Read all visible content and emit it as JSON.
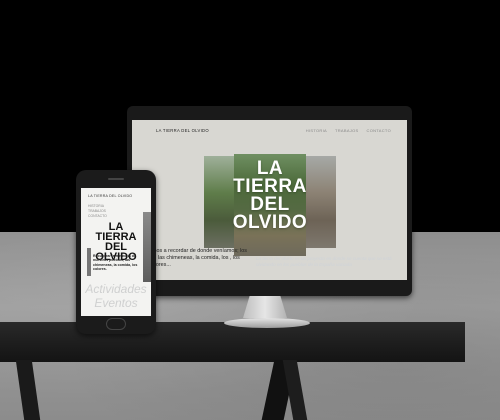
{
  "desktop": {
    "site_logo": "LA TIERRA DEL OLVIDO",
    "nav": [
      "HISTORIA",
      "TRABAJOS",
      "CONTACTO"
    ],
    "hero_title_lines": [
      "LA",
      "TIERRA",
      "DEL",
      "OLVIDO"
    ],
    "body_text": "amos a recordar de donde veníamos; los do, las chimeneas, la comida, los , los colores...",
    "side_text": "La tierra del olvido es un proyecto en donde se cuenta que se está olvidando en los pueblos de la España vaciada"
  },
  "mobile": {
    "site_logo": "LA TIERRA DEL OLVIDO",
    "menu": [
      "HISTORIA",
      "TRABAJOS",
      "CONTACTO"
    ],
    "title_lines": [
      "LA",
      "TIERRA",
      "DEL",
      "OLVIDO"
    ],
    "body_text": "Recuperar la memoria de nuestros pueblos, las chimeneas, la comida, los colores.",
    "big_labels": [
      "Actividades",
      "Eventos"
    ]
  },
  "colors": {
    "screen_bg": "#d8d7d2",
    "hero_text": "#ffffff",
    "accent_text": "#cfd3d8"
  }
}
